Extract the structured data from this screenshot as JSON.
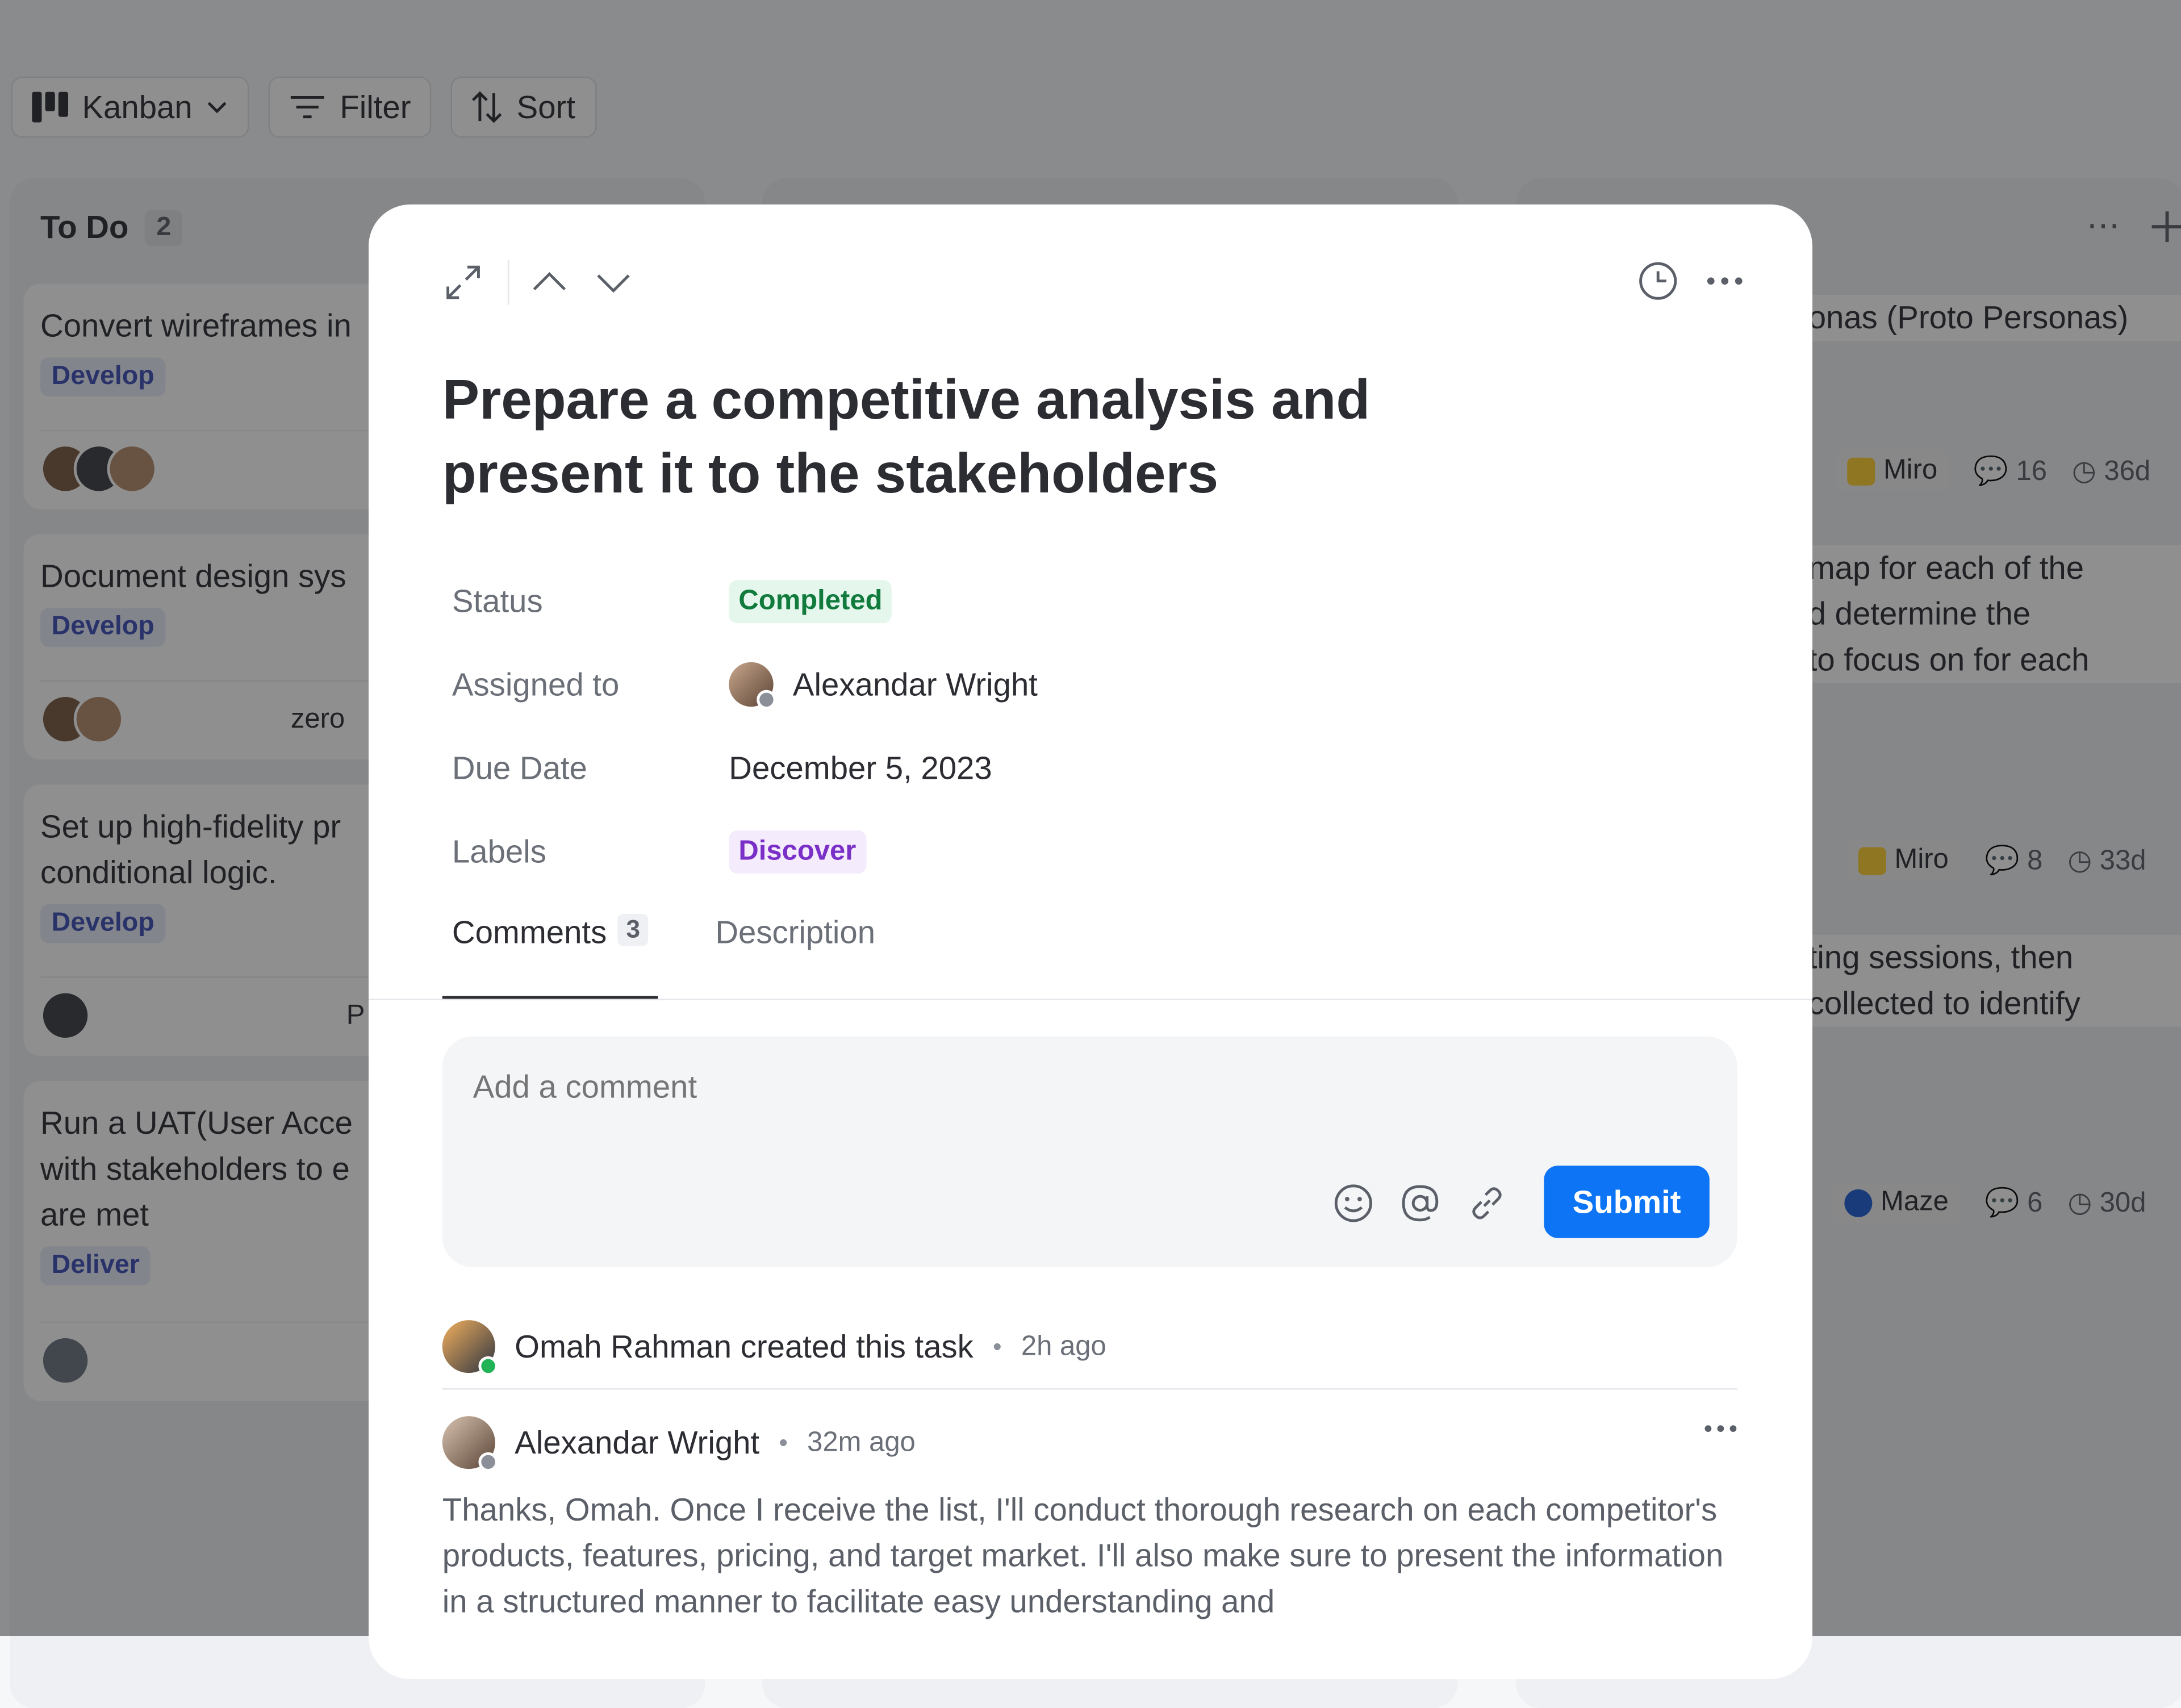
{
  "toolbar": {
    "view_label": "Kanban",
    "filter_label": "Filter",
    "sort_label": "Sort"
  },
  "board": {
    "todo": {
      "title": "To Do",
      "count": "2",
      "cards": [
        {
          "title": "Convert wireframes in",
          "label": "Develop"
        },
        {
          "title": "Document design sys",
          "label": "Develop",
          "app": "zero"
        },
        {
          "title": "Set up high-fidelity pr\nconditional logic.",
          "label": "Develop",
          "app": "P"
        },
        {
          "title": "Run a UAT(User Acce\nwith stakeholders to e\nare met",
          "label": "Deliver"
        }
      ]
    },
    "right_cards": [
      {
        "text": "onas (Proto Personas)",
        "app": "Miro",
        "comments": "16",
        "days": "36d"
      },
      {
        "text": "map for each of the\nd determine the\n to focus on for each",
        "app": "Miro",
        "comments": "8",
        "days": "33d"
      },
      {
        "text": "ting sessions, then\ncollected to identify",
        "app": "Maze",
        "comments": "6",
        "days": "30d"
      }
    ]
  },
  "task": {
    "title": "Prepare a competitive analysis and present it to the stakeholders",
    "status_label": "Status",
    "status_value": "Completed",
    "assigned_label": "Assigned to",
    "assignee": "Alexandar Wright",
    "due_label": "Due Date",
    "due_value": "December 5, 2023",
    "labels_label": "Labels",
    "label_value": "Discover"
  },
  "tabs": [
    {
      "label": "Comments",
      "count": "3"
    },
    {
      "label": "Description"
    }
  ],
  "composer": {
    "placeholder": "Add a comment",
    "submit_label": "Submit"
  },
  "activity": {
    "text": "Omah Rahman created this task",
    "time": "2h ago"
  },
  "comment": {
    "author": "Alexandar Wright",
    "time": "32m ago",
    "body": "Thanks, Omah. Once I receive the list, I'll conduct thorough research on each competitor's products, features, pricing, and target market. I'll also make sure to present the information in a structured manner to facilitate easy understanding and"
  },
  "colors": {
    "accent": "#0d74f6",
    "completed_bg": "#e5f7ec",
    "completed_text": "#117a3d",
    "discover_bg": "#f4ecfc",
    "discover_text": "#7a2fc7"
  }
}
